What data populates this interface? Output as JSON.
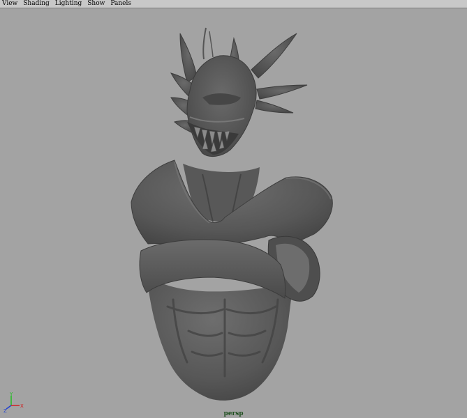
{
  "menubar": {
    "items": [
      {
        "label": "View"
      },
      {
        "label": "Shading"
      },
      {
        "label": "Lighting"
      },
      {
        "label": "Show"
      },
      {
        "label": "Panels"
      }
    ]
  },
  "viewport": {
    "camera_label": "persp",
    "background_color": "#a3a3a3",
    "model_color": "#5a5a5a"
  },
  "axis_indicator": {
    "y_label": "Y",
    "x_label": "X",
    "z_label": "Z",
    "y_color": "#1fbf1f",
    "x_color": "#d02020",
    "z_color": "#2040d0"
  }
}
